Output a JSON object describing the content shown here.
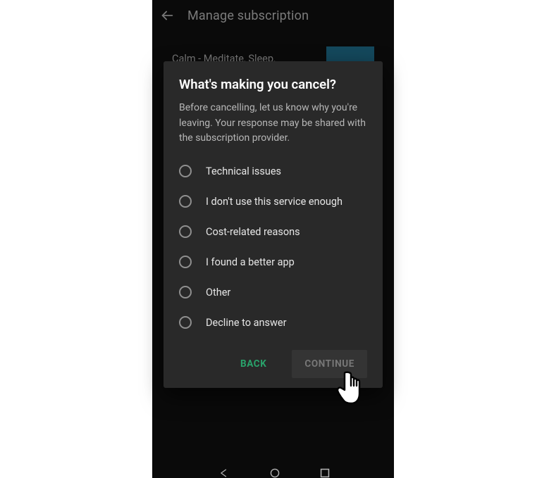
{
  "header": {
    "title": "Manage subscription"
  },
  "background": {
    "app_name_line1": "Calm - Meditate, Sleep,"
  },
  "modal": {
    "title": "What's making you cancel?",
    "description": "Before cancelling, let us know why you're leaving. Your response may be shared with the subscription provider.",
    "options": [
      {
        "label": "Technical issues"
      },
      {
        "label": "I don't use this service enough"
      },
      {
        "label": "Cost-related reasons"
      },
      {
        "label": "I found a better app"
      },
      {
        "label": "Other"
      },
      {
        "label": "Decline to answer"
      }
    ],
    "actions": {
      "back": "BACK",
      "continue": "CONTINUE"
    }
  }
}
